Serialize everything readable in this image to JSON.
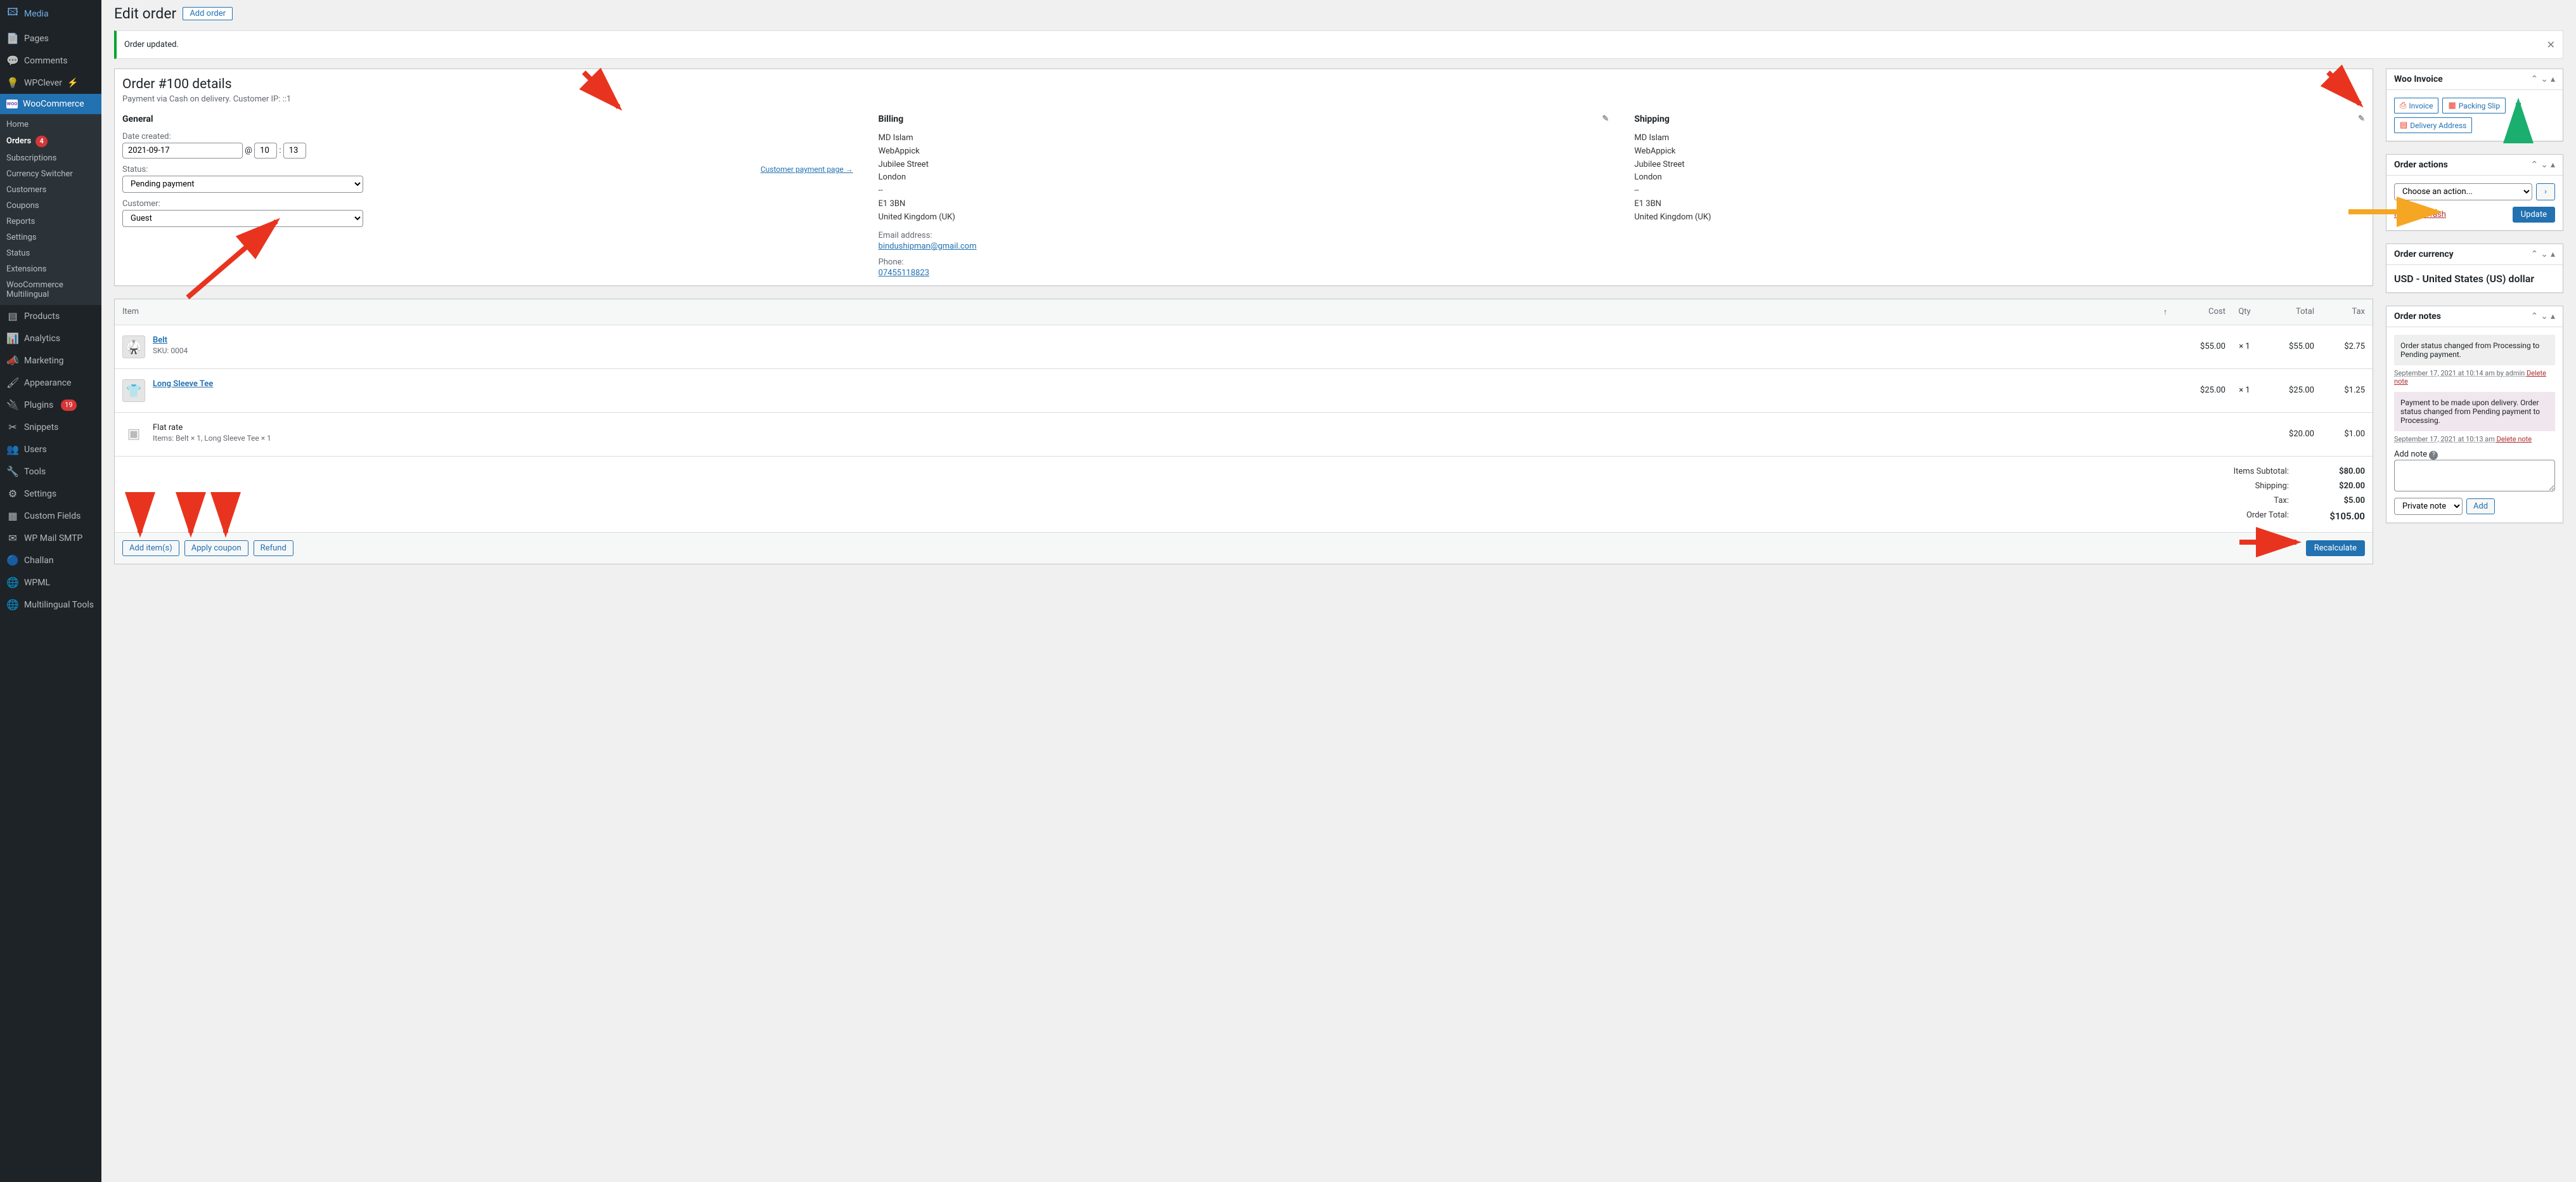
{
  "sidebar": {
    "items": [
      {
        "icon": "🖾",
        "label": "Media"
      },
      {
        "icon": "📄",
        "label": "Pages"
      },
      {
        "icon": "💬",
        "label": "Comments"
      },
      {
        "icon": "💡",
        "label": "WPClever",
        "lightning": true
      },
      {
        "icon": "woo",
        "label": "WooCommerce",
        "active": true
      },
      {
        "icon": "▤",
        "label": "Products"
      },
      {
        "icon": "📊",
        "label": "Analytics"
      },
      {
        "icon": "📣",
        "label": "Marketing"
      },
      {
        "icon": "🖌",
        "label": "Appearance"
      },
      {
        "icon": "🔌",
        "label": "Plugins",
        "badge": "19"
      },
      {
        "icon": "✂",
        "label": "Snippets"
      },
      {
        "icon": "👥",
        "label": "Users"
      },
      {
        "icon": "🔧",
        "label": "Tools"
      },
      {
        "icon": "⚙",
        "label": "Settings"
      },
      {
        "icon": "▦",
        "label": "Custom Fields"
      },
      {
        "icon": "✉",
        "label": "WP Mail SMTP"
      },
      {
        "icon": "🔵",
        "label": "Challan"
      },
      {
        "icon": "🌐",
        "label": "WPML"
      },
      {
        "icon": "🌐",
        "label": "Multilingual Tools"
      }
    ],
    "submenu": [
      "Home",
      "Orders",
      "Subscriptions",
      "Currency Switcher",
      "Customers",
      "Coupons",
      "Reports",
      "Settings",
      "Status",
      "Extensions",
      "WooCommerce Multilingual"
    ],
    "orders_badge": "4"
  },
  "header": {
    "title": "Edit order",
    "add_order": "Add order"
  },
  "notice": "Order updated.",
  "order": {
    "title": "Order #100 details",
    "meta": "Payment via Cash on delivery. Customer IP: ::1",
    "general": {
      "heading": "General",
      "date_label": "Date created:",
      "date": "2021-09-17",
      "hour": "10",
      "min": "13",
      "status_label": "Status:",
      "payment_page": "Customer payment page →",
      "status": "Pending payment",
      "customer_label": "Customer:",
      "customer": "Guest"
    },
    "billing": {
      "heading": "Billing",
      "lines": [
        "MD Islam",
        "WebAppick",
        "Jubilee Street",
        "London",
        "--",
        "E1 3BN",
        "United Kingdom (UK)"
      ],
      "email_label": "Email address:",
      "email": "bindushipman@gmail.com",
      "phone_label": "Phone:",
      "phone": "07455118823"
    },
    "shipping": {
      "heading": "Shipping",
      "lines": [
        "MD Islam",
        "WebAppick",
        "Jubilee Street",
        "London",
        "--",
        "E1 3BN",
        "United Kingdom (UK)"
      ]
    }
  },
  "items": {
    "headers": {
      "item": "Item",
      "cost": "Cost",
      "qty": "Qty",
      "total": "Total",
      "tax": "Tax"
    },
    "rows": [
      {
        "name": "Belt",
        "sku": "SKU: 0004",
        "cost": "$55.00",
        "qty": "× 1",
        "total": "$55.00",
        "tax": "$2.75",
        "emoji": "🥋"
      },
      {
        "name": "Long Sleeve Tee",
        "sku": "",
        "cost": "$25.00",
        "qty": "× 1",
        "total": "$25.00",
        "tax": "$1.25",
        "emoji": "👕"
      }
    ],
    "shipping": {
      "label": "Flat rate",
      "items": "Items:  Belt × 1, Long Sleeve Tee × 1",
      "total": "$20.00",
      "tax": "$1.00"
    },
    "totals": [
      {
        "label": "Items Subtotal:",
        "val": "$80.00"
      },
      {
        "label": "Shipping:",
        "val": "$20.00"
      },
      {
        "label": "Tax:",
        "val": "$5.00"
      },
      {
        "label": "Order Total:",
        "val": "$105.00"
      }
    ],
    "buttons": {
      "add": "Add item(s)",
      "coupon": "Apply coupon",
      "refund": "Refund",
      "recalc": "Recalculate"
    }
  },
  "side": {
    "woo_invoice": {
      "title": "Woo Invoice",
      "invoice": "Invoice",
      "packing": "Packing Slip",
      "delivery": "Delivery Address"
    },
    "order_actions": {
      "title": "Order actions",
      "placeholder": "Choose an action...",
      "trash": "Move to Trash",
      "update": "Update"
    },
    "currency": {
      "title": "Order currency",
      "value": "USD - United States (US) dollar"
    },
    "notes": {
      "title": "Order notes",
      "list": [
        {
          "text": "Order status changed from Processing to Pending payment.",
          "meta": "September 17, 2021 at 10:14 am by admin",
          "cls": "sys",
          "del": "Delete note"
        },
        {
          "text": "Payment to be made upon delivery. Order status changed from Pending payment to Processing.",
          "meta": "September 17, 2021 at 10:13 am",
          "cls": "pay",
          "del": "Delete note"
        }
      ],
      "add_label": "Add note",
      "note_type": "Private note",
      "add_btn": "Add"
    }
  }
}
